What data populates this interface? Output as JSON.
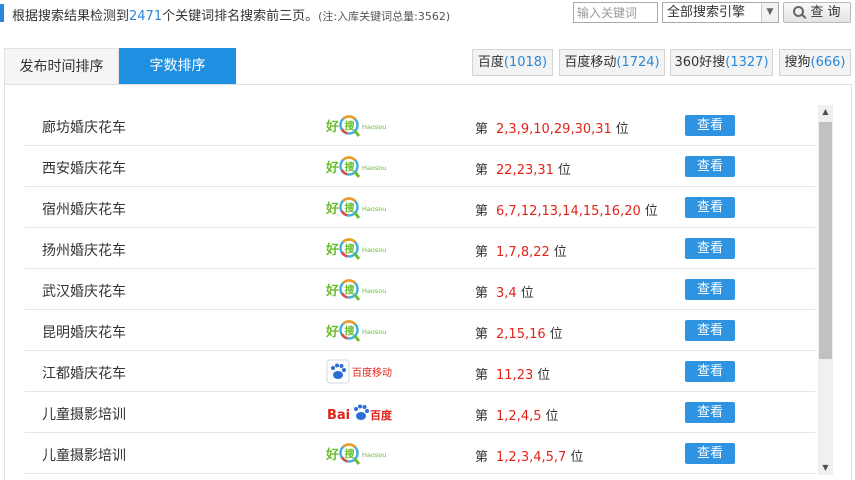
{
  "summary": {
    "prefix": "根据搜索结果检测到",
    "count": "2471",
    "suffix": "个关键词排名搜索前三页。",
    "note": "(注:入库关键词总量:3562)"
  },
  "search": {
    "placeholder": "输入关键词",
    "engine_selected": "全部搜索引擎",
    "query_label": "查 询"
  },
  "sort_tabs": [
    {
      "label": "发布时间排序",
      "active": false
    },
    {
      "label": "字数排序",
      "active": true
    }
  ],
  "engine_tabs": [
    {
      "name": "百度",
      "count": "(1018)"
    },
    {
      "name": "百度移动",
      "count": "(1724)"
    },
    {
      "name": "360好搜",
      "count": "(1327)"
    },
    {
      "name": "搜狗",
      "count": "(666)"
    }
  ],
  "rank_prefix": "第",
  "rank_suffix": "位",
  "view_label": "查看",
  "logos": {
    "haosou": {
      "text": "好搜",
      "sub": "Haosou"
    },
    "baidu_mobile": {
      "text": "百度移动"
    },
    "baidu": {
      "text_a": "Bai",
      "text_b": "百度"
    }
  },
  "rows": [
    {
      "keyword": "廊坊婚庆花车",
      "engine": "haosou",
      "ranks": "2,3,9,10,29,30,31"
    },
    {
      "keyword": "西安婚庆花车",
      "engine": "haosou",
      "ranks": "22,23,31"
    },
    {
      "keyword": "宿州婚庆花车",
      "engine": "haosou",
      "ranks": "6,7,12,13,14,15,16,20"
    },
    {
      "keyword": "扬州婚庆花车",
      "engine": "haosou",
      "ranks": "1,7,8,22"
    },
    {
      "keyword": "武汉婚庆花车",
      "engine": "haosou",
      "ranks": "3,4"
    },
    {
      "keyword": "昆明婚庆花车",
      "engine": "haosou",
      "ranks": "2,15,16"
    },
    {
      "keyword": "江都婚庆花车",
      "engine": "baidu_mobile",
      "ranks": "11,23"
    },
    {
      "keyword": "儿童摄影培训",
      "engine": "baidu",
      "ranks": "1,2,4,5"
    },
    {
      "keyword": "儿童摄影培训",
      "engine": "haosou",
      "ranks": "1,2,3,4,5,7"
    }
  ],
  "colors": {
    "accent": "#1e8fe1",
    "rank_red": "#e2231a",
    "count_blue": "#2b88d8"
  }
}
